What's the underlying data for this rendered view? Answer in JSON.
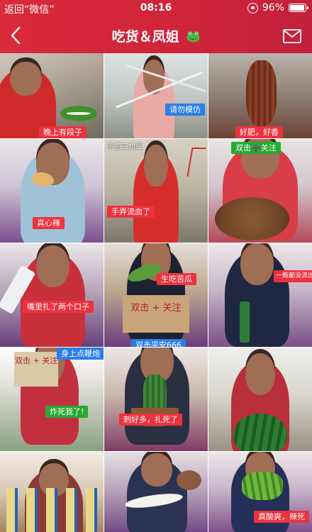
{
  "status_bar": {
    "back_label": "返回“微信”",
    "time": "08:16",
    "battery": "96%",
    "battery_level": 0.96
  },
  "nav": {
    "title": "吃货＆凤姐"
  },
  "colors": {
    "header_red": "#d0243b",
    "caption_red": "#ec323e",
    "caption_blue": "#2a7ee8",
    "caption_green": "#27a833"
  },
  "tiles": [
    {
      "caption": "晚上有段子"
    },
    {
      "caption": "请勿模仿"
    },
    {
      "caption": "好肥，好香"
    },
    {
      "caption": "真心辣"
    },
    {
      "caption": "手弄流血了",
      "top_text": "手抓三角蛋"
    },
    {
      "caption": "双击➕关注"
    },
    {
      "caption": "嘴里扎了两个口子"
    },
    {
      "caption": "生吃苦瓜",
      "caption2": "双击平安666",
      "sign_text": "双击 + 关注"
    },
    {
      "caption": "一瓶都没流出来"
    },
    {
      "caption": "炸死我了!",
      "caption2": "身上点鞭炮",
      "sign_text": "双击 + 关注"
    },
    {
      "caption": "刺好多，扎死了"
    },
    {
      "caption": ""
    },
    {
      "caption": ""
    },
    {
      "caption": ""
    },
    {
      "caption": "真酸爽，辣死"
    }
  ]
}
